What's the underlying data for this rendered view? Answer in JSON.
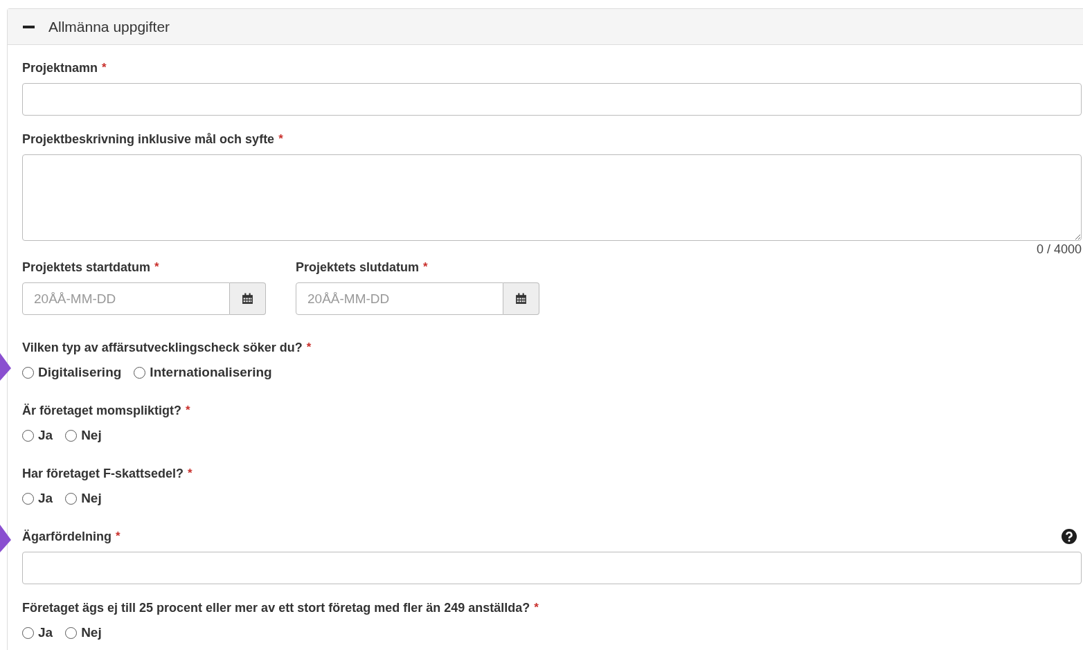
{
  "section": {
    "title": "Allmänna uppgifter",
    "expanded": true
  },
  "fields": [
    {
      "kind": "text",
      "label": "Projektnamn",
      "required_mark": "*"
    },
    {
      "kind": "textarea",
      "label": "Projektbeskrivning inklusive mål och syfte",
      "required_mark": "*",
      "counter": "0 / 4000"
    },
    {
      "kind": "dates",
      "items": [
        {
          "label": "Projektets startdatum",
          "required_mark": "*",
          "placeholder": "20ÅÅ-MM-DD"
        },
        {
          "label": "Projektets slutdatum",
          "required_mark": "*",
          "placeholder": "20ÅÅ-MM-DD"
        }
      ]
    },
    {
      "kind": "radio",
      "label": "Vilken typ av affärsutvecklingscheck söker du?",
      "required_mark": "*",
      "options": [
        {
          "label": "Digitalisering",
          "selected": false
        },
        {
          "label": "Internationalisering",
          "selected": false
        }
      ]
    },
    {
      "kind": "radio",
      "label": "Är företaget momspliktigt?",
      "required_mark": "*",
      "options": [
        {
          "label": "Ja",
          "selected": false
        },
        {
          "label": "Nej",
          "selected": false
        }
      ]
    },
    {
      "kind": "radio",
      "label": "Har företaget F-skattsedel?",
      "required_mark": "*",
      "options": [
        {
          "label": "Ja",
          "selected": false
        },
        {
          "label": "Nej",
          "selected": false
        }
      ]
    },
    {
      "kind": "text",
      "label": "Ägarfördelning",
      "required_mark": "*",
      "help": true
    },
    {
      "kind": "radio",
      "label": "Företaget ägs ej till 25 procent eller mer av ett stort företag med fler än 249 anställda?",
      "required_mark": "*",
      "options": [
        {
          "label": "Ja",
          "selected": false
        },
        {
          "label": "Nej",
          "selected": false
        }
      ]
    }
  ]
}
